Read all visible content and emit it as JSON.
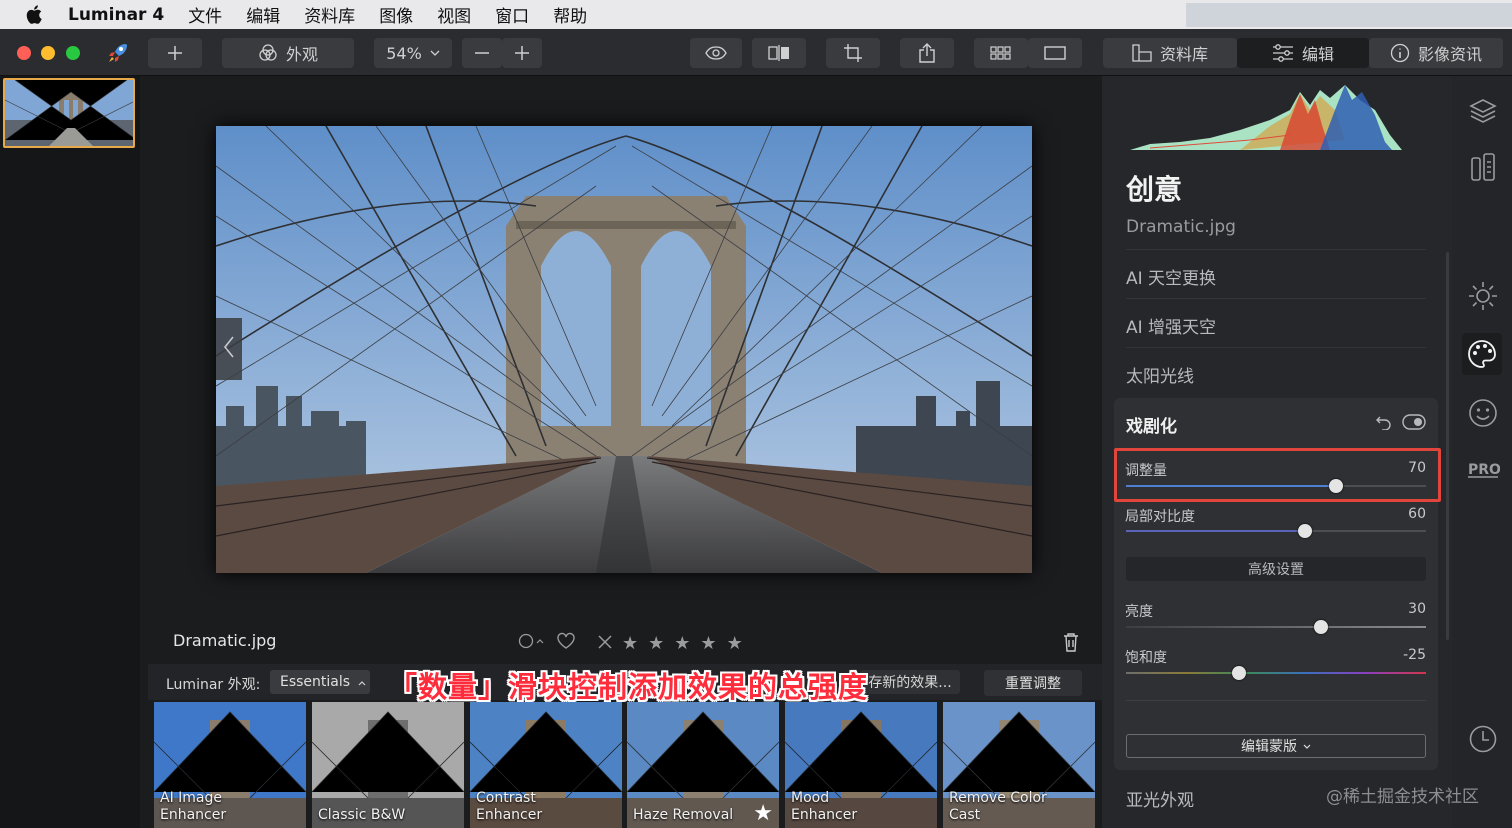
{
  "menubar": {
    "app_name": "Luminar 4",
    "items": [
      "文件",
      "编辑",
      "资料库",
      "图像",
      "视图",
      "窗口",
      "帮助"
    ]
  },
  "toolbar": {
    "looks_label": "外观",
    "zoom": "54%",
    "tab_library": "资料库",
    "tab_edit": "编辑",
    "tab_info": "影像资讯"
  },
  "canvas": {
    "filename": "Dramatic.jpg"
  },
  "looks": {
    "label": "Luminar 外观:",
    "collection": "Essentials",
    "save_partial": "存新的效果...",
    "reset": "重置调整",
    "annotation": "「数量」滑块控制添加效果的总强度",
    "items": [
      {
        "line1": "AI Image",
        "line2": "Enhancer"
      },
      {
        "line1": "",
        "line2": "Classic B&W"
      },
      {
        "line1": "Contrast",
        "line2": "Enhancer"
      },
      {
        "line1": "",
        "line2": "Haze Removal"
      },
      {
        "line1": "Mood",
        "line2": "Enhancer"
      },
      {
        "line1": "Remove Color",
        "line2": "Cast"
      }
    ]
  },
  "panel": {
    "title": "创意",
    "file": "Dramatic.jpg",
    "tools": [
      "AI 天空更换",
      "AI 增强天空",
      "太阳光线"
    ],
    "drama": {
      "title": "戏剧化",
      "sliders": [
        {
          "label": "调整量",
          "value": "70",
          "fraction": 0.7
        },
        {
          "label": "局部对比度",
          "value": "60",
          "fraction": 0.595
        },
        {
          "label": "亮度",
          "value": "30",
          "fraction": 0.65
        },
        {
          "label": "饱和度",
          "value": "-25",
          "fraction": 0.375
        }
      ],
      "advanced": "高级设置",
      "mask": "编辑蒙版"
    },
    "next_tool": "亚光外观",
    "watermark": "@稀土掘金技术社区"
  },
  "colors": {
    "accent_highlight": "#e2453c",
    "thumb_border": "#e8a94a",
    "annotation_text": "#ff2d3c"
  }
}
